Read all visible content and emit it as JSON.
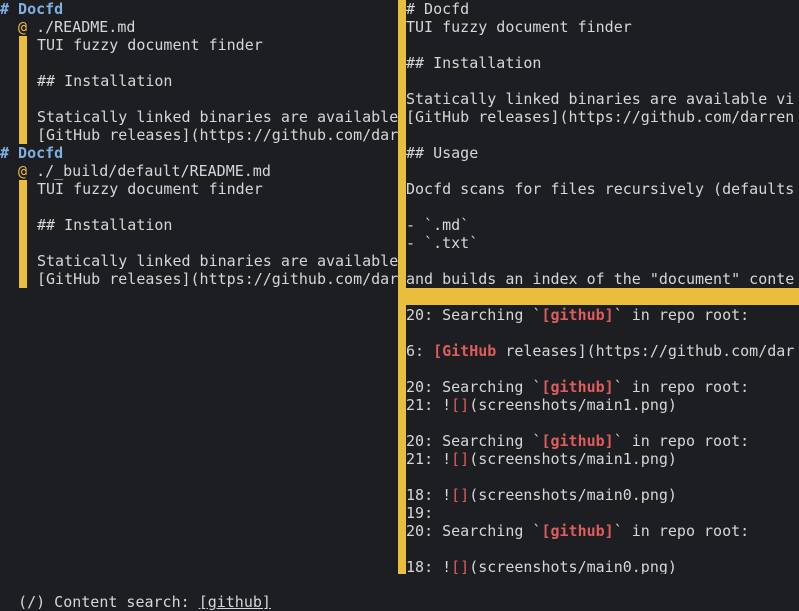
{
  "left_pane": {
    "results": [
      {
        "heading": "# Docfd",
        "path": "./README.md",
        "lines": [
          "TUI fuzzy document finder",
          "",
          "## Installation",
          "",
          "Statically linked binaries are available",
          "[GitHub releases](https://github.com/dar"
        ]
      },
      {
        "heading": "# Docfd",
        "path": "./_build/default/README.md",
        "lines": [
          "TUI fuzzy document finder",
          "",
          "## Installation",
          "",
          "Statically linked binaries are available",
          "[GitHub releases](https://github.com/dar"
        ]
      }
    ],
    "at_symbol": "@"
  },
  "right_pane": {
    "preview_lines": [
      "# Docfd",
      "TUI fuzzy document finder",
      "",
      "## Installation",
      "",
      "Statically linked binaries are available vi",
      "[GitHub releases](https://github.com/darren",
      "",
      "## Usage",
      "",
      "Docfd scans for files recursively (defaults",
      "",
      "- `.md`",
      "- `.txt`",
      "",
      "and builds an index of the \"document\" conte"
    ],
    "search_results": [
      {
        "lines": [
          {
            "num": "20",
            "pre": " Searching `",
            "match": "[github]",
            "post": "` in repo root:"
          }
        ]
      },
      {
        "lines": [
          {
            "num": "6",
            "pre": " ",
            "match": "[GitHub",
            "post": " releases](https://github.com/dar"
          }
        ]
      },
      {
        "lines": [
          {
            "num": "20",
            "pre": " Searching `",
            "match": "[github]",
            "post": "` in repo root:"
          },
          {
            "num": "21",
            "pre": " !",
            "bracket": "[]",
            "post": "(screenshots/main1.png)"
          }
        ]
      },
      {
        "lines": [
          {
            "num": "20",
            "pre": " Searching `",
            "match": "[github]",
            "post": "` in repo root:"
          },
          {
            "num": "21",
            "pre": " !",
            "bracket": "[]",
            "post": "(screenshots/main1.png)"
          }
        ]
      },
      {
        "lines": [
          {
            "num": "18",
            "pre": " !",
            "bracket": "[]",
            "post": "(screenshots/main0.png)"
          },
          {
            "num": "19",
            "pre": "",
            "post": ""
          },
          {
            "num": "20",
            "pre": " Searching `",
            "match": "[github]",
            "post": "` in repo root:"
          }
        ]
      },
      {
        "lines": [
          {
            "num": "18",
            "pre": " !",
            "bracket": "[]",
            "post": "(screenshots/main0.png)"
          }
        ]
      }
    ]
  },
  "status_bar": {
    "label": "(/) Content search: ",
    "query": "[github]"
  },
  "colors": {
    "background": "#1c1e21",
    "text": "#d6d6d6",
    "heading": "#7fb0e0",
    "accent_bar": "#e8be3a",
    "match": "#e05c5c"
  }
}
